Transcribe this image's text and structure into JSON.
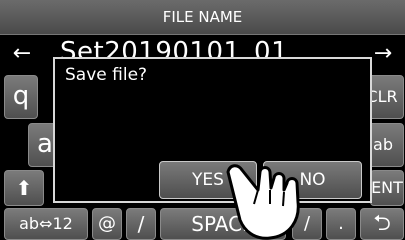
{
  "header": {
    "title": "FILE NAME"
  },
  "field": {
    "value": "Set20190101_01",
    "left_arrow": "←",
    "right_arrow": "→"
  },
  "keys": {
    "q": "q",
    "clr": "CLR",
    "a": "a",
    "ab": "ab",
    "shift": "⬆",
    "ent": "ENT",
    "ab_mode": "ab⇔12",
    "at": "@",
    "slash": "/",
    "space": "SPACE",
    "space_right_partial": "/",
    "dot": ".",
    "back": "⮌"
  },
  "dialog": {
    "message": "Save file?",
    "yes": "YES",
    "no": "NO"
  }
}
